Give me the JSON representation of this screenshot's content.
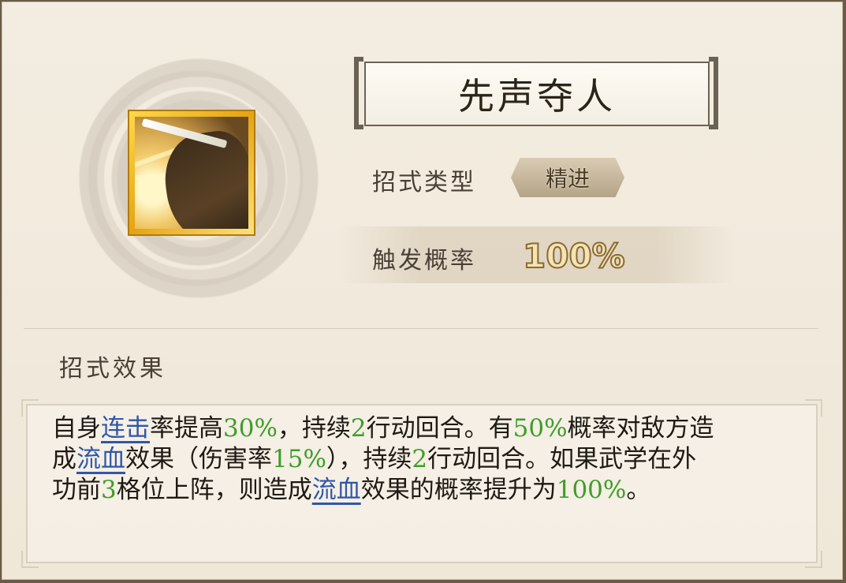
{
  "skill": {
    "name": "先声夺人",
    "type_label": "招式类型",
    "type_value": "精进",
    "rate_label": "触发概率",
    "rate_value": "100%"
  },
  "effect": {
    "title": "招式效果",
    "line1": [
      {
        "t": "自身",
        "s": "n"
      },
      {
        "t": "连击",
        "s": "u"
      },
      {
        "t": "率提高",
        "s": "n"
      },
      {
        "t": "30%",
        "s": "g"
      },
      {
        "t": "，持续",
        "s": "n"
      },
      {
        "t": "2",
        "s": "g"
      },
      {
        "t": "行动回合。有",
        "s": "n"
      },
      {
        "t": "50%",
        "s": "g"
      },
      {
        "t": "概率对敌方造",
        "s": "n"
      }
    ],
    "line2": [
      {
        "t": "成",
        "s": "n"
      },
      {
        "t": "流血",
        "s": "u"
      },
      {
        "t": "效果（伤害率",
        "s": "n"
      },
      {
        "t": "15%",
        "s": "g"
      },
      {
        "t": "），持续",
        "s": "n"
      },
      {
        "t": "2",
        "s": "g"
      },
      {
        "t": "行动回合。如果武学在外",
        "s": "n"
      }
    ],
    "line3": [
      {
        "t": "功前",
        "s": "n"
      },
      {
        "t": "3",
        "s": "g"
      },
      {
        "t": "格位上阵，则造成",
        "s": "n"
      },
      {
        "t": "流血",
        "s": "u"
      },
      {
        "t": "效果的概率提升为",
        "s": "n"
      },
      {
        "t": "100%",
        "s": "g"
      },
      {
        "t": "。",
        "s": "n"
      }
    ]
  },
  "icons": {
    "skill_icon": "swordsman-strike-icon",
    "background": "cloud-emblem-icon"
  },
  "colors": {
    "highlight_number": "#3f9d28",
    "keyword_link": "#2f57a7",
    "icon_frame": "#e5a412"
  }
}
